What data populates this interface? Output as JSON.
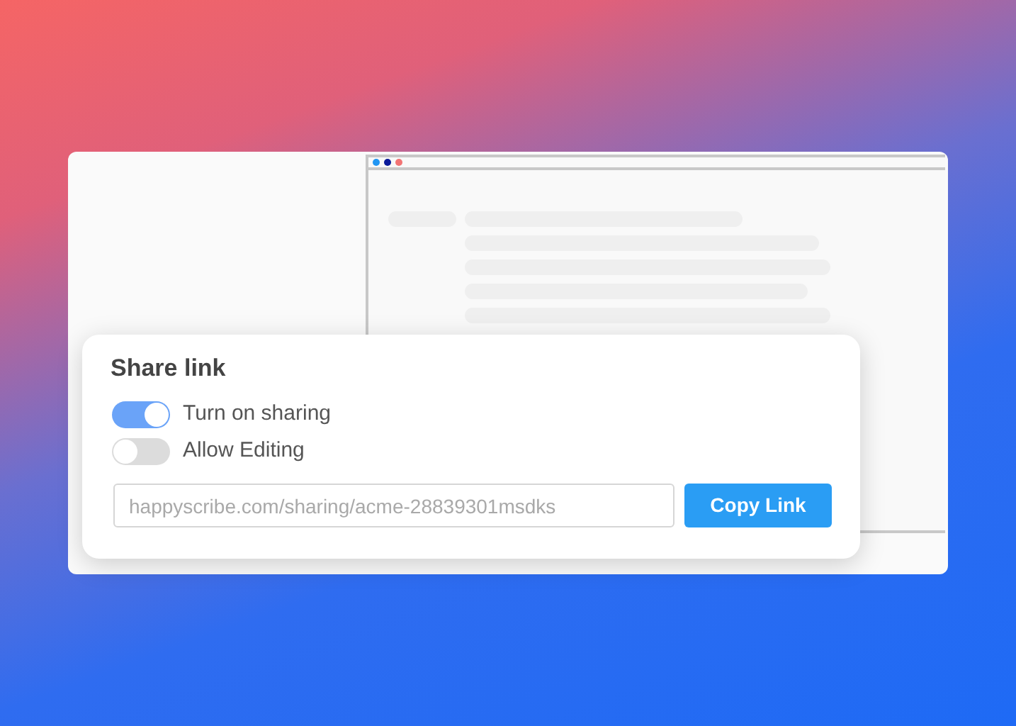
{
  "window": {
    "dots": [
      {
        "color": "#2196f3"
      },
      {
        "color": "#0a1a9a"
      },
      {
        "color": "#f27474"
      }
    ]
  },
  "dialog": {
    "title": "Share link",
    "toggles": [
      {
        "label": "Turn on sharing",
        "on": true
      },
      {
        "label": "Allow Editing",
        "on": false
      }
    ],
    "link_field": {
      "value": "happyscribe.com/sharing/acme-28839301msdks"
    },
    "button": "Copy Link"
  }
}
